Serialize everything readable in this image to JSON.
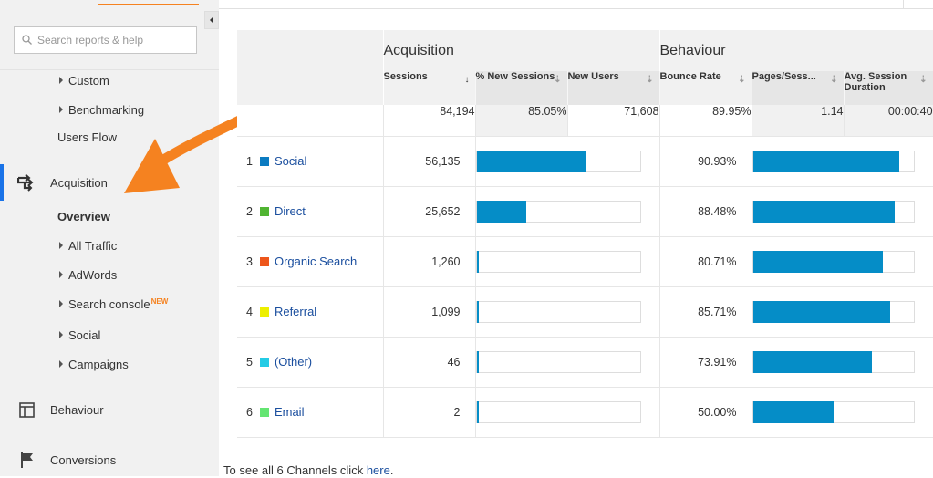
{
  "sidebar": {
    "search_placeholder": "Search reports & help",
    "items": {
      "custom": "Custom",
      "benchmarking": "Benchmarking",
      "users_flow": "Users Flow",
      "acquisition": "Acquisition",
      "overview": "Overview",
      "all_traffic": "All Traffic",
      "adwords": "AdWords",
      "search_console": "Search console",
      "search_console_badge": "NEW",
      "social": "Social",
      "campaigns": "Campaigns",
      "behaviour": "Behaviour",
      "conversions": "Conversions"
    }
  },
  "table": {
    "groups": {
      "acquisition": "Acquisition",
      "behaviour": "Behaviour"
    },
    "columns": {
      "sessions": "Sessions",
      "new_sessions": "% New Sessions",
      "new_users": "New Users",
      "bounce_rate": "Bounce Rate",
      "pages_session": "Pages/Sess...",
      "avg_duration": "Avg. Session Duration"
    },
    "totals": {
      "sessions": "84,194",
      "new_sessions": "85.05%",
      "new_users": "71,608",
      "bounce_rate": "89.95%",
      "pages_session": "1.14",
      "avg_duration": "00:00:40"
    },
    "rows": [
      {
        "num": "1",
        "channel": "Social",
        "color": "#0b7bc1",
        "sessions": "56,135",
        "sessions_share": 0.667,
        "bounce": "90.93%",
        "bounce_share": 0.9093
      },
      {
        "num": "2",
        "channel": "Direct",
        "color": "#50b432",
        "sessions": "25,652",
        "sessions_share": 0.305,
        "bounce": "88.48%",
        "bounce_share": 0.8848
      },
      {
        "num": "3",
        "channel": "Organic Search",
        "color": "#ed561b",
        "sessions": "1,260",
        "sessions_share": 0.015,
        "bounce": "80.71%",
        "bounce_share": 0.8071
      },
      {
        "num": "4",
        "channel": "Referral",
        "color": "#edef00",
        "sessions": "1,099",
        "sessions_share": 0.013,
        "bounce": "85.71%",
        "bounce_share": 0.8571
      },
      {
        "num": "5",
        "channel": "(Other)",
        "color": "#24cbe5",
        "sessions": "46",
        "sessions_share": 0.0005,
        "bounce": "73.91%",
        "bounce_share": 0.7391
      },
      {
        "num": "6",
        "channel": "Email",
        "color": "#64e572",
        "sessions": "2",
        "sessions_share": 2e-05,
        "bounce": "50.00%",
        "bounce_share": 0.5
      }
    ]
  },
  "footer": {
    "text": "To see all 6 Channels click ",
    "link": "here",
    "suffix": "."
  },
  "colors": {
    "accent": "#f58220",
    "bar": "#058dc7",
    "link": "#1a4e9e",
    "active": "#1a73e8"
  }
}
